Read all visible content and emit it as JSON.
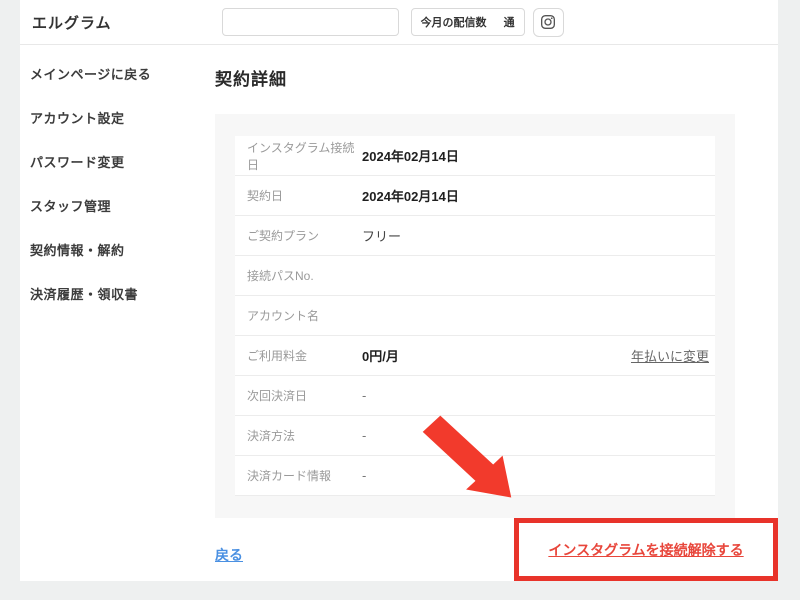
{
  "header": {
    "brand": "エルグラム",
    "search": {
      "value": "",
      "placeholder": ""
    },
    "stat": {
      "label": "今月の配信数",
      "value": "",
      "unit": "通"
    },
    "instagram_icon": "instagram-icon"
  },
  "sidebar": {
    "items": [
      {
        "label": "メインページに戻る"
      },
      {
        "label": "アカウント設定"
      },
      {
        "label": "パスワード変更"
      },
      {
        "label": "スタッフ管理"
      },
      {
        "label": "契約情報・解約"
      },
      {
        "label": "決済履歴・領収書"
      }
    ]
  },
  "main": {
    "title": "契約詳細",
    "table": {
      "rows": [
        {
          "label": "インスタグラム接続日",
          "value": "2024年02月14日",
          "bold": true
        },
        {
          "label": "契約日",
          "value": "2024年02月14日",
          "bold": true
        },
        {
          "label": "ご契約プラン",
          "value": "フリー"
        },
        {
          "label": "接続パスNo.",
          "value": ""
        },
        {
          "label": "アカウント名",
          "value": ""
        },
        {
          "label": "ご利用料金",
          "value": "0円/月",
          "bold": true,
          "action": "年払いに変更"
        },
        {
          "label": "次回決済日",
          "value": "-",
          "muted": true
        },
        {
          "label": "決済方法",
          "value": "-",
          "muted": true
        },
        {
          "label": "決済カード情報",
          "value": "-",
          "muted": true
        }
      ]
    },
    "back_link": "戻る",
    "disconnect_link": "インスタグラムを接続解除する"
  },
  "colors": {
    "annotation_red": "#f23a2c",
    "frame_red": "#e8332a",
    "link_red": "#e8463b",
    "link_blue": "#4a90e2",
    "card_bg": "#f7f7f7"
  }
}
